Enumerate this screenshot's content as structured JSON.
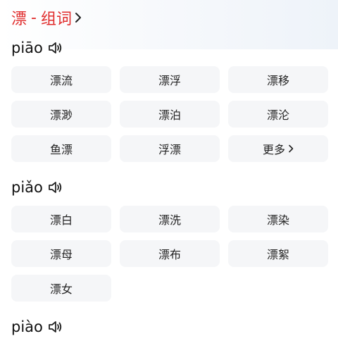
{
  "title": {
    "char": "漂",
    "separator": "-",
    "label": "组词"
  },
  "sections": [
    {
      "pinyin": "piāo",
      "words": [
        "漂流",
        "漂浮",
        "漂移",
        "漂渺",
        "漂泊",
        "漂沦",
        "鱼漂",
        "浮漂"
      ],
      "more_label": "更多"
    },
    {
      "pinyin": "piǎo",
      "words": [
        "漂白",
        "漂洗",
        "漂染",
        "漂母",
        "漂布",
        "漂絮",
        "漂女"
      ]
    },
    {
      "pinyin": "piào"
    }
  ],
  "colors": {
    "accent": "#e02a2a",
    "cell_bg": "#f5f6f8"
  },
  "icons": {
    "speaker": "speaker-icon",
    "chevron": "chevron-right-icon"
  }
}
